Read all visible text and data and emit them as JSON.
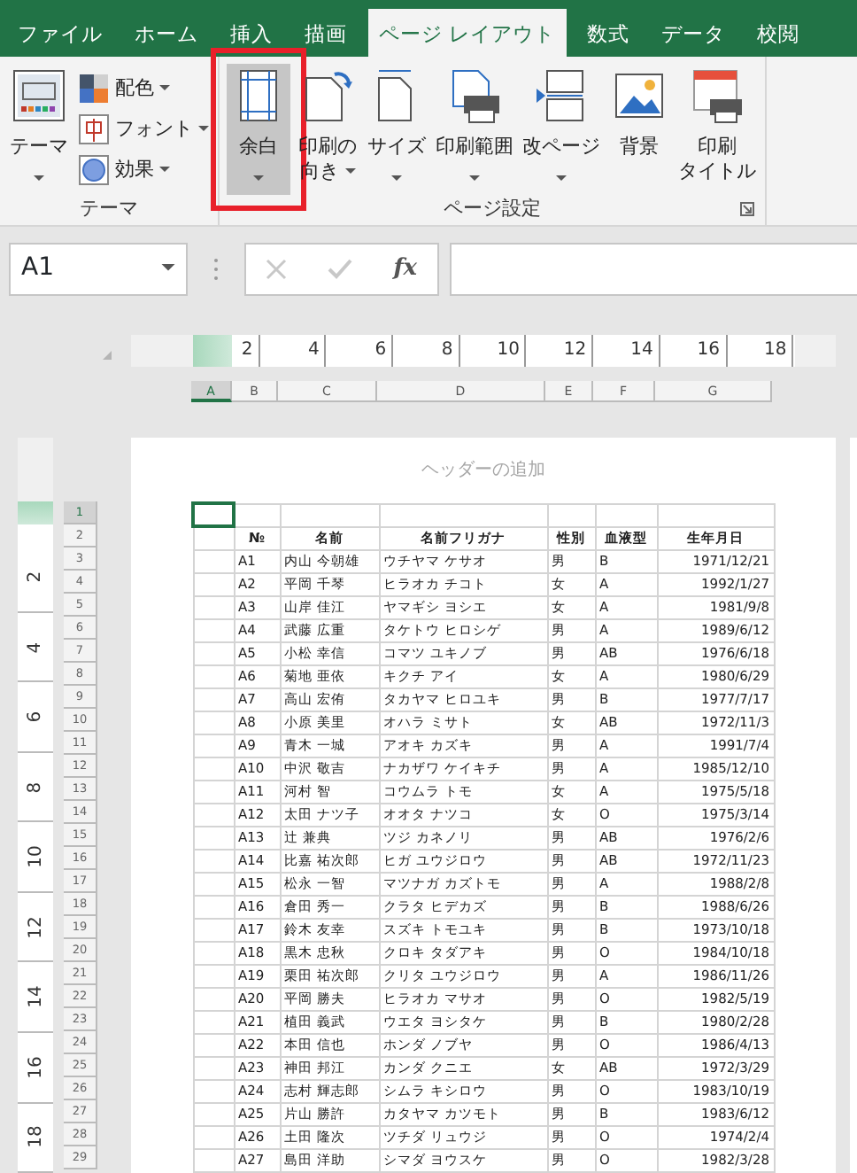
{
  "tabs": [
    {
      "label": "ファイル",
      "selected": false
    },
    {
      "label": "ホーム",
      "selected": false
    },
    {
      "label": "挿入",
      "selected": false
    },
    {
      "label": "描画",
      "selected": false
    },
    {
      "label": "ページ レイアウト",
      "selected": true
    },
    {
      "label": "数式",
      "selected": false
    },
    {
      "label": "データ",
      "selected": false
    },
    {
      "label": "校閲",
      "selected": false
    }
  ],
  "ribbon": {
    "groups": [
      {
        "label": "テーマ",
        "large_buttons": [
          {
            "kind": "theme",
            "lines": [
              "テーマ"
            ],
            "dropdown": true,
            "selected": false
          }
        ],
        "small_buttons": [
          {
            "kind": "colors",
            "label": "配色"
          },
          {
            "kind": "fonts",
            "label": "フォント"
          },
          {
            "kind": "effects",
            "label": "効果"
          }
        ]
      },
      {
        "label": "ページ設定",
        "launcher": true,
        "large_buttons": [
          {
            "kind": "margins",
            "lines": [
              "余白"
            ],
            "dropdown": true,
            "selected": true,
            "highlighted": true
          },
          {
            "kind": "orientation",
            "lines": [
              "印刷の",
              "向き"
            ],
            "dropdown": true,
            "selected": false,
            "highlighted": false
          },
          {
            "kind": "size",
            "lines": [
              "サイズ"
            ],
            "dropdown": true,
            "selected": false,
            "highlighted": false
          },
          {
            "kind": "print_area",
            "lines": [
              "印刷範囲"
            ],
            "dropdown": true,
            "selected": false,
            "highlighted": false
          },
          {
            "kind": "breaks",
            "lines": [
              "改ページ"
            ],
            "dropdown": true,
            "selected": false,
            "highlighted": false
          },
          {
            "kind": "background",
            "lines": [
              "背景"
            ],
            "dropdown": false,
            "selected": false,
            "highlighted": false
          },
          {
            "kind": "print_titles",
            "lines": [
              "印刷",
              "タイトル"
            ],
            "dropdown": false,
            "selected": false,
            "highlighted": false
          }
        ]
      }
    ]
  },
  "formula_bar": {
    "name_box": "A1",
    "function_button": "fx"
  },
  "ruler": {
    "labels": [
      "2",
      "4",
      "6",
      "8",
      "10",
      "12",
      "14",
      "16",
      "18"
    ]
  },
  "vertical_ruler": {
    "labels": [
      "2",
      "4",
      "6",
      "8",
      "10",
      "12",
      "14",
      "16",
      "18"
    ]
  },
  "column_headers": [
    {
      "label": "A",
      "selected": true
    },
    {
      "label": "B",
      "selected": false
    },
    {
      "label": "C",
      "selected": false
    },
    {
      "label": "D",
      "selected": false
    },
    {
      "label": "E",
      "selected": false
    },
    {
      "label": "F",
      "selected": false
    },
    {
      "label": "G",
      "selected": false
    }
  ],
  "row_headers": [
    {
      "label": "1",
      "selected": true
    },
    {
      "label": "2",
      "selected": false
    },
    {
      "label": "3",
      "selected": false
    },
    {
      "label": "4",
      "selected": false
    },
    {
      "label": "5",
      "selected": false
    },
    {
      "label": "6",
      "selected": false
    },
    {
      "label": "7",
      "selected": false
    },
    {
      "label": "8",
      "selected": false
    },
    {
      "label": "9",
      "selected": false
    },
    {
      "label": "10",
      "selected": false
    },
    {
      "label": "11",
      "selected": false
    },
    {
      "label": "12",
      "selected": false
    },
    {
      "label": "13",
      "selected": false
    },
    {
      "label": "14",
      "selected": false
    },
    {
      "label": "15",
      "selected": false
    },
    {
      "label": "16",
      "selected": false
    },
    {
      "label": "17",
      "selected": false
    },
    {
      "label": "18",
      "selected": false
    },
    {
      "label": "19",
      "selected": false
    },
    {
      "label": "20",
      "selected": false
    },
    {
      "label": "21",
      "selected": false
    },
    {
      "label": "22",
      "selected": false
    },
    {
      "label": "23",
      "selected": false
    },
    {
      "label": "24",
      "selected": false
    },
    {
      "label": "25",
      "selected": false
    },
    {
      "label": "26",
      "selected": false
    },
    {
      "label": "27",
      "selected": false
    },
    {
      "label": "28",
      "selected": false
    },
    {
      "label": "29",
      "selected": false
    }
  ],
  "page": {
    "header_placeholder": "ヘッダーの追加",
    "table": {
      "columns": [
        "№",
        "名前",
        "名前フリガナ",
        "性別",
        "血液型",
        "生年月日"
      ],
      "rows": [
        [
          "A1",
          "内山 今朝雄",
          "ウチヤマ ケサオ",
          "男",
          "B",
          "1971/12/21"
        ],
        [
          "A2",
          "平岡 千琴",
          "ヒラオカ チコト",
          "女",
          "A",
          "1992/1/27"
        ],
        [
          "A3",
          "山岸 佳江",
          "ヤマギシ ヨシエ",
          "女",
          "A",
          "1981/9/8"
        ],
        [
          "A4",
          "武藤 広重",
          "タケトウ ヒロシゲ",
          "男",
          "A",
          "1989/6/12"
        ],
        [
          "A5",
          "小松 幸信",
          "コマツ ユキノブ",
          "男",
          "AB",
          "1976/6/18"
        ],
        [
          "A6",
          "菊地 亜依",
          "キクチ アイ",
          "女",
          "A",
          "1980/6/29"
        ],
        [
          "A7",
          "高山 宏侑",
          "タカヤマ ヒロユキ",
          "男",
          "B",
          "1977/7/17"
        ],
        [
          "A8",
          "小原 美里",
          "オハラ ミサト",
          "女",
          "AB",
          "1972/11/3"
        ],
        [
          "A9",
          "青木 一城",
          "アオキ カズキ",
          "男",
          "A",
          "1991/7/4"
        ],
        [
          "A10",
          "中沢 敬吉",
          "ナカザワ ケイキチ",
          "男",
          "A",
          "1985/12/10"
        ],
        [
          "A11",
          "河村 智",
          "コウムラ トモ",
          "女",
          "A",
          "1975/5/18"
        ],
        [
          "A12",
          "太田 ナツ子",
          "オオタ ナツコ",
          "女",
          "O",
          "1975/3/14"
        ],
        [
          "A13",
          "辻 兼典",
          "ツジ カネノリ",
          "男",
          "AB",
          "1976/2/6"
        ],
        [
          "A14",
          "比嘉 祐次郎",
          "ヒガ ユウジロウ",
          "男",
          "AB",
          "1972/11/23"
        ],
        [
          "A15",
          "松永 一智",
          "マツナガ カズトモ",
          "男",
          "A",
          "1988/2/8"
        ],
        [
          "A16",
          "倉田 秀一",
          "クラタ ヒデカズ",
          "男",
          "B",
          "1988/6/26"
        ],
        [
          "A17",
          "鈴木 友幸",
          "スズキ トモユキ",
          "男",
          "B",
          "1973/10/18"
        ],
        [
          "A18",
          "黒木 忠秋",
          "クロキ タダアキ",
          "男",
          "O",
          "1984/10/18"
        ],
        [
          "A19",
          "栗田 祐次郎",
          "クリタ ユウジロウ",
          "男",
          "A",
          "1986/11/26"
        ],
        [
          "A20",
          "平岡 勝夫",
          "ヒラオカ マサオ",
          "男",
          "O",
          "1982/5/19"
        ],
        [
          "A21",
          "植田 義武",
          "ウエタ ヨシタケ",
          "男",
          "B",
          "1980/2/28"
        ],
        [
          "A22",
          "本田 信也",
          "ホンダ ノブヤ",
          "男",
          "O",
          "1986/4/13"
        ],
        [
          "A23",
          "神田 邦江",
          "カンダ クニエ",
          "女",
          "AB",
          "1972/3/29"
        ],
        [
          "A24",
          "志村 輝志郎",
          "シムラ キシロウ",
          "男",
          "O",
          "1983/10/19"
        ],
        [
          "A25",
          "片山 勝許",
          "カタヤマ カツモト",
          "男",
          "B",
          "1983/6/12"
        ],
        [
          "A26",
          "土田 隆次",
          "ツチダ リュウジ",
          "男",
          "O",
          "1974/2/4"
        ],
        [
          "A27",
          "島田 洋助",
          "シマダ ヨウスケ",
          "男",
          "O",
          "1982/3/28"
        ]
      ]
    }
  }
}
